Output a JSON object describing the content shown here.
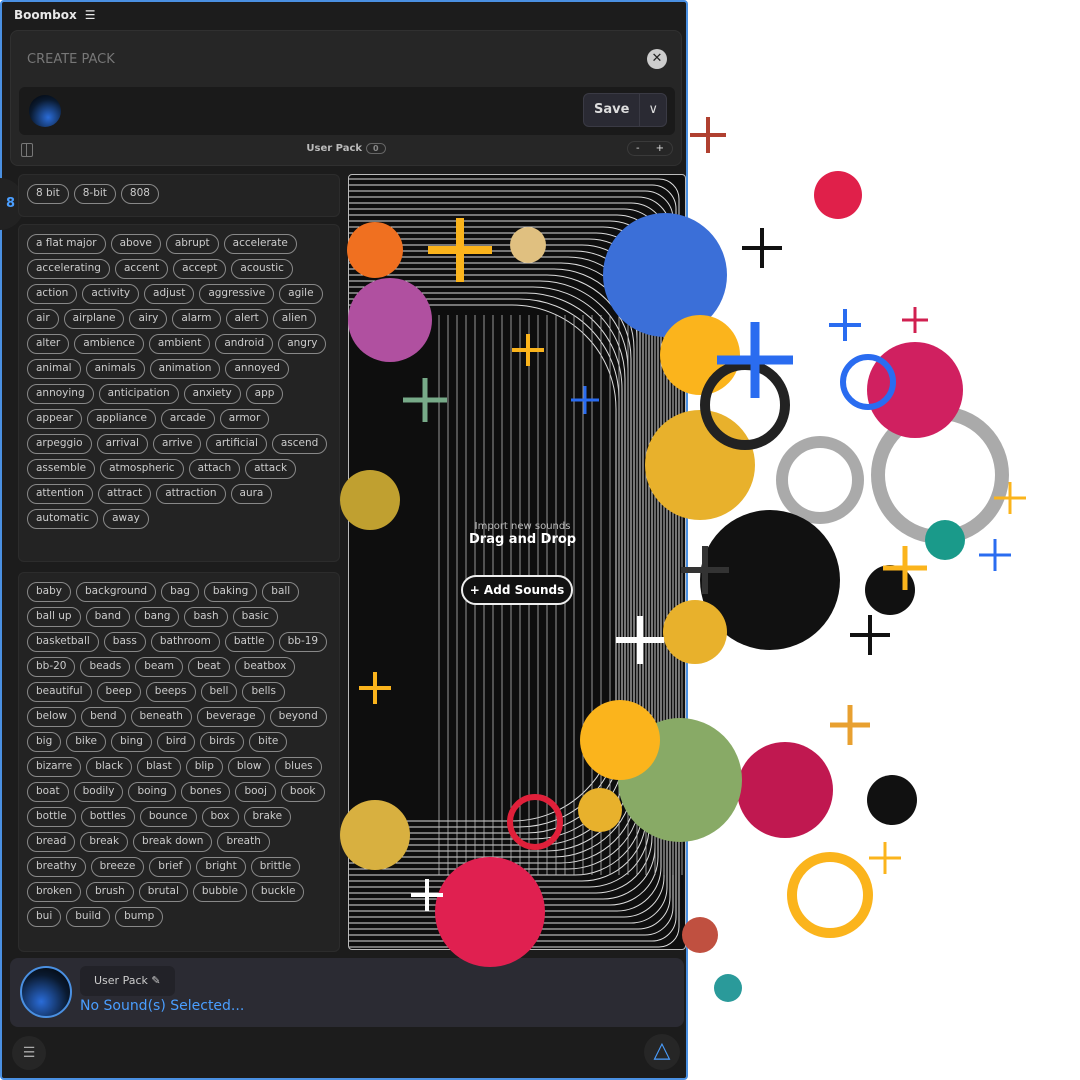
{
  "app": {
    "title": "Boombox",
    "menu_icon": "hamburger-icon"
  },
  "create_pack": {
    "title": "CREATE PACK",
    "close_icon": "close-icon",
    "name_value": "",
    "save_label": "Save",
    "save_dropdown_icon": "chevron-down-icon",
    "pack_label": "User Pack",
    "pack_count": "0",
    "minus": "-",
    "plus": "+"
  },
  "side_badge": "8",
  "tag_groups": [
    [
      "8 bit",
      "8-bit",
      "808"
    ],
    [
      "a flat major",
      "above",
      "abrupt",
      "accelerate",
      "accelerating",
      "accent",
      "accept",
      "acoustic",
      "action",
      "activity",
      "adjust",
      "aggressive",
      "agile",
      "air",
      "airplane",
      "airy",
      "alarm",
      "alert",
      "alien",
      "alter",
      "ambience",
      "ambient",
      "android",
      "angry",
      "animal",
      "animals",
      "animation",
      "annoyed",
      "annoying",
      "anticipation",
      "anxiety",
      "app",
      "appear",
      "appliance",
      "arcade",
      "armor",
      "arpeggio",
      "arrival",
      "arrive",
      "artificial",
      "ascend",
      "assemble",
      "atmospheric",
      "attach",
      "attack",
      "attention",
      "attract",
      "attraction",
      "aura",
      "automatic",
      "away"
    ],
    [
      "baby",
      "background",
      "bag",
      "baking",
      "ball",
      "ball up",
      "band",
      "bang",
      "bash",
      "basic",
      "basketball",
      "bass",
      "bathroom",
      "battle",
      "bb-19",
      "bb-20",
      "beads",
      "beam",
      "beat",
      "beatbox",
      "beautiful",
      "beep",
      "beeps",
      "bell",
      "bells",
      "below",
      "bend",
      "beneath",
      "beverage",
      "beyond",
      "big",
      "bike",
      "bing",
      "bird",
      "birds",
      "bite",
      "bizarre",
      "black",
      "blast",
      "blip",
      "blow",
      "blues",
      "boat",
      "bodily",
      "boing",
      "bones",
      "booj",
      "book",
      "bottle",
      "bottles",
      "bounce",
      "box",
      "brake",
      "bread",
      "break",
      "break down",
      "breath",
      "breathy",
      "breeze",
      "brief",
      "bright",
      "brittle",
      "broken",
      "brush",
      "brutal",
      "bubble",
      "buckle",
      "bui",
      "build",
      "bump"
    ]
  ],
  "drop_zone": {
    "subtitle": "Import new sounds",
    "title": "Drag and Drop",
    "add_button": "+ Add Sounds"
  },
  "bottom_bar": {
    "pack_button": "User Pack",
    "edit_icon": "pencil-icon",
    "status": "No Sound(s) Selected..."
  },
  "footer": {
    "mixer_icon": "sliders-icon",
    "logo_icon": "triangle-icon"
  },
  "colors": {
    "accent": "#4a9eff",
    "window_border": "#4a90e2",
    "background": "#1c1c1c"
  }
}
